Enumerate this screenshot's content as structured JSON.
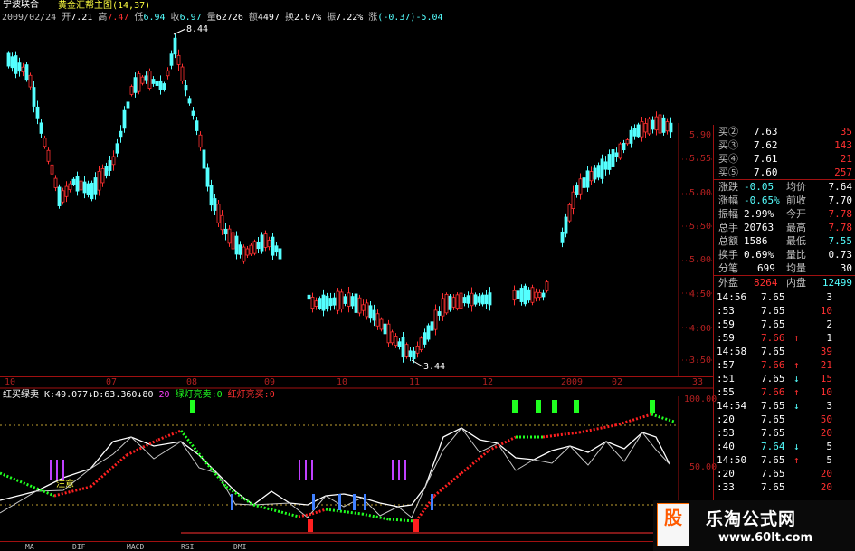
{
  "header": {
    "title": "宁波联合",
    "date": "2009/02/24",
    "open_label": "开",
    "open": "7.21",
    "high_label": "高",
    "high": "7.47",
    "low_label": "低",
    "low": "6.94",
    "close_label": "收",
    "close": "6.97",
    "vol_label": "量",
    "vol": "62726",
    "amt_label": "额",
    "amt": "4497",
    "turn_label": "换",
    "turn": "2.07%",
    "amp_label": "振",
    "amp": "7.22%",
    "chg_label": "涨",
    "chg": "(-0.37)-5.04",
    "indicator_main": "黄金汇帮主图(14,37)"
  },
  "main_chart": {
    "high_marker": "8.44",
    "low_marker": "3.44",
    "price_ticks": [
      "5.90",
      "5.55",
      "5.00",
      "5.50",
      "5.00",
      "4.50",
      "4.00",
      "3.50"
    ],
    "time_ticks": [
      "10",
      "07",
      "08",
      "09",
      "10",
      "11",
      "12",
      "2009",
      "02",
      "33"
    ]
  },
  "sub_chart": {
    "name": "红买绿卖",
    "k_label": "K:49.077",
    "d_label": "D:63.360",
    "j_label": "80",
    "n_label": "20",
    "green_signal": "绿灯亮卖:0",
    "red_signal": "红灯亮买:0",
    "note": "注意",
    "scale_top": "100.00",
    "scale_mid": "50.00",
    "tabs": [
      "MA",
      "DIF",
      "MACD",
      "RSI",
      "DMI"
    ]
  },
  "quote_panel": {
    "bids": [
      {
        "label": "买②",
        "price": "7.63",
        "vol": "35"
      },
      {
        "label": "买③",
        "price": "7.62",
        "vol": "143"
      },
      {
        "label": "买④",
        "price": "7.61",
        "vol": "21"
      },
      {
        "label": "买⑤",
        "price": "7.60",
        "vol": "257"
      }
    ],
    "stats": [
      {
        "l1": "涨跌",
        "v1": "-0.05",
        "l2": "均价",
        "v2": "7.64"
      },
      {
        "l1": "涨幅",
        "v1": "-0.65%",
        "l2": "前收",
        "v2": "7.70"
      },
      {
        "l1": "振幅",
        "v1": "2.99%",
        "l2": "今开",
        "v2": "7.78"
      },
      {
        "l1": "总手",
        "v1": "20763",
        "l2": "最高",
        "v2": "7.78"
      },
      {
        "l1": "总额",
        "v1": "1586",
        "l2": "最低",
        "v2": "7.55"
      },
      {
        "l1": "换手",
        "v1": "0.69%",
        "l2": "量比",
        "v2": "0.73"
      },
      {
        "l1": "分笔",
        "v1": "699",
        "l2": "均量",
        "v2": "30"
      }
    ],
    "outer_label": "外盘",
    "outer": "8264",
    "inner_label": "内盘",
    "inner": "12499",
    "ticks": [
      {
        "t": "14:56",
        "p": "7.65",
        "a": "",
        "v": "3"
      },
      {
        "t": ":53",
        "p": "7.65",
        "a": "",
        "v": "10"
      },
      {
        "t": ":59",
        "p": "7.65",
        "a": "",
        "v": "2"
      },
      {
        "t": ":59",
        "p": "7.66",
        "a": "up",
        "v": "1"
      },
      {
        "t": "14:58",
        "p": "7.65",
        "a": "",
        "v": "39"
      },
      {
        "t": ":57",
        "p": "7.66",
        "a": "up",
        "v": "21"
      },
      {
        "t": ":51",
        "p": "7.65",
        "a": "down",
        "v": "15"
      },
      {
        "t": ":55",
        "p": "7.66",
        "a": "up",
        "v": "10"
      },
      {
        "t": "14:54",
        "p": "7.65",
        "a": "down",
        "v": "3"
      },
      {
        "t": ":20",
        "p": "7.65",
        "a": "",
        "v": "50"
      },
      {
        "t": ":53",
        "p": "7.65",
        "a": "",
        "v": "20"
      },
      {
        "t": ":40",
        "p": "7.64",
        "a": "down",
        "v": "5"
      },
      {
        "t": "14:50",
        "p": "7.65",
        "a": "up",
        "v": "5"
      },
      {
        "t": ":20",
        "p": "7.65",
        "a": "",
        "v": "20"
      },
      {
        "t": ":33",
        "p": "7.65",
        "a": "",
        "v": "20"
      }
    ]
  },
  "watermark": {
    "logo_char": "股",
    "title": "乐淘公式网",
    "url": "www.60lt.com"
  },
  "colors": {
    "up": "#ff3030",
    "down": "#54ffff",
    "grid": "#a01010",
    "k_line": "#ffffff",
    "d_line": "#c8c8c8"
  }
}
